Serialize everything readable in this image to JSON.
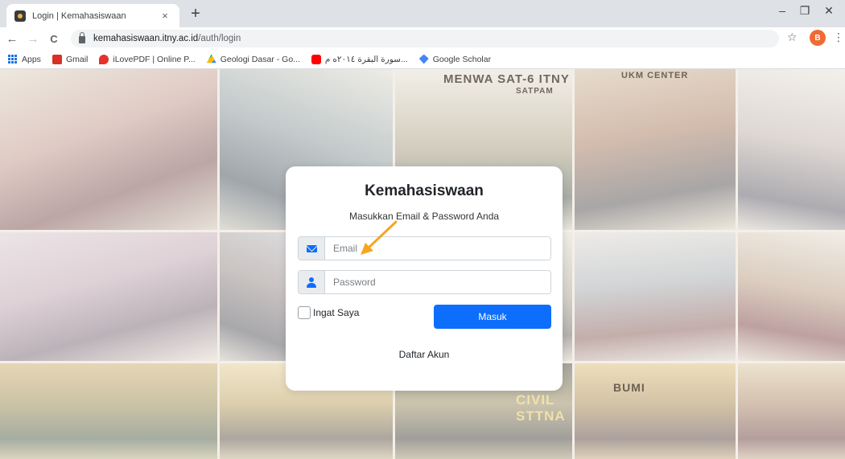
{
  "browser": {
    "tab_title": "Login | Kemahasiswaan",
    "tab_close": "×",
    "new_tab": "+",
    "window_controls": {
      "minimize": "–",
      "restore": "❐",
      "close": "✕"
    },
    "nav": {
      "back": "←",
      "forward": "→",
      "reload": "C"
    },
    "url_host": "kemahasiswaan.itny.ac.id",
    "url_path": "/auth/login",
    "star": "☆",
    "profile_initial": "B",
    "menu": "⋮",
    "bookmarks": [
      {
        "label": "Apps",
        "icon": "apps-grid-icon"
      },
      {
        "label": "Gmail",
        "icon": "gmail-icon",
        "color": "#d93025"
      },
      {
        "label": "iLovePDF | Online P...",
        "icon": "ilovepdf-icon",
        "color": "#e5322d"
      },
      {
        "label": "Geologi Dasar - Go...",
        "icon": "google-drive-icon",
        "color": "#fbbc04"
      },
      {
        "label": "سورة البقرة ٢٠١٤ه م...",
        "icon": "youtube-icon",
        "color": "#ff0000"
      },
      {
        "label": "Google Scholar",
        "icon": "google-scholar-icon",
        "color": "#4285f4"
      }
    ]
  },
  "background": {
    "banner_menwa": "MENWA SAT-6 ITNY",
    "banner_satpam": "SATPAM",
    "banner_ukm": "UKM CENTER",
    "banner_civil": "CIVIL STTNA",
    "banner_bumi": "BUMI"
  },
  "login": {
    "title": "Kemahasiswaan",
    "subtitle": "Masukkan Email & Password Anda",
    "email_placeholder": "Email",
    "password_placeholder": "Password",
    "remember_label": "Ingat Saya",
    "submit_label": "Masuk",
    "register_label": "Daftar Akun"
  },
  "colors": {
    "primary": "#0d6efd",
    "annotation_arrow": "#f5a623",
    "profile_avatar": "#f06a35"
  }
}
